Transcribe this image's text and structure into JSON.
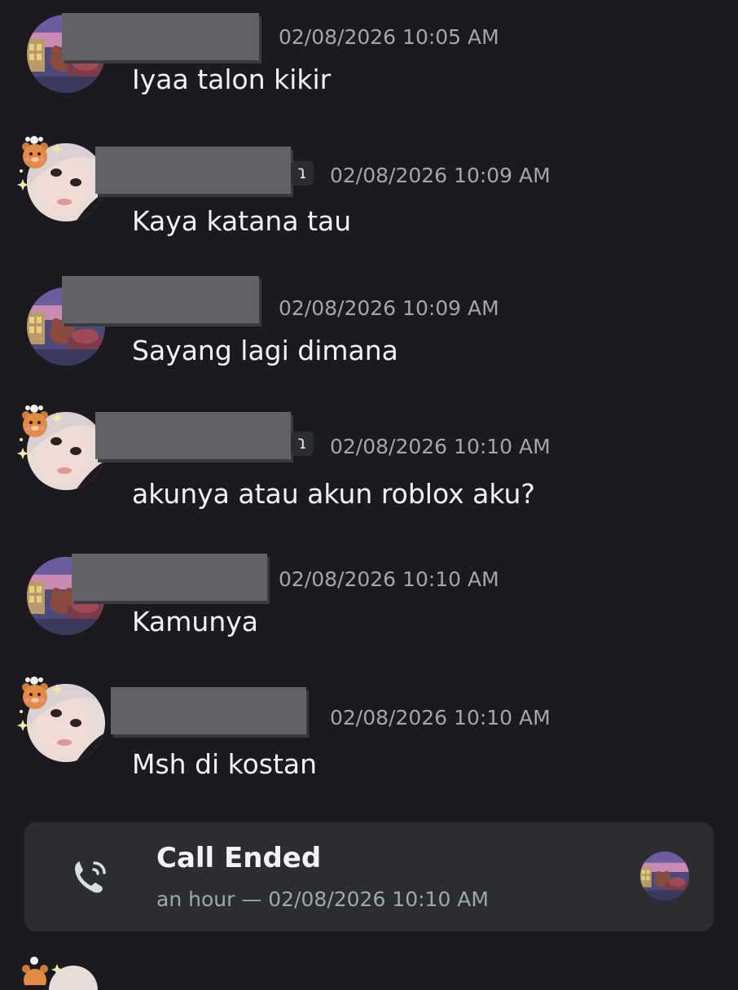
{
  "messages": [
    {
      "author": "redacted",
      "timestamp": "02/08/2026 10:05 AM",
      "text": "Iyaa talon kikir",
      "avatar": "room-avatar",
      "badge": false
    },
    {
      "author": "redacted",
      "timestamp": "02/08/2026 10:09 AM",
      "text": "Kaya katana tau",
      "avatar": "girl-avatar",
      "badge": true
    },
    {
      "author": "redacted",
      "timestamp": "02/08/2026 10:09 AM",
      "text": "Sayang lagi dimana",
      "avatar": "room-avatar",
      "badge": false
    },
    {
      "author": "redacted",
      "timestamp": "02/08/2026 10:10 AM",
      "text": "akunya atau akun roblox aku?",
      "avatar": "girl-avatar",
      "badge": true
    },
    {
      "author": "redacted",
      "timestamp": "02/08/2026 10:10 AM",
      "text": "Kamunya",
      "avatar": "room-avatar",
      "badge": false
    },
    {
      "author": "redacted",
      "timestamp": "02/08/2026 10:10 AM",
      "text": "Msh di kostan",
      "avatar": "girl-avatar",
      "badge": false
    }
  ],
  "call": {
    "title": "Call Ended",
    "subtitle": "an hour — 02/08/2026 10:10 AM",
    "icon": "phone-call-icon"
  },
  "badge_glyph": "ɿ",
  "colors": {
    "background": "#1b1b1f",
    "card": "#2b2d31",
    "text": "#f2f3f5",
    "muted": "#a3a6ad",
    "redaction": "#616166"
  }
}
